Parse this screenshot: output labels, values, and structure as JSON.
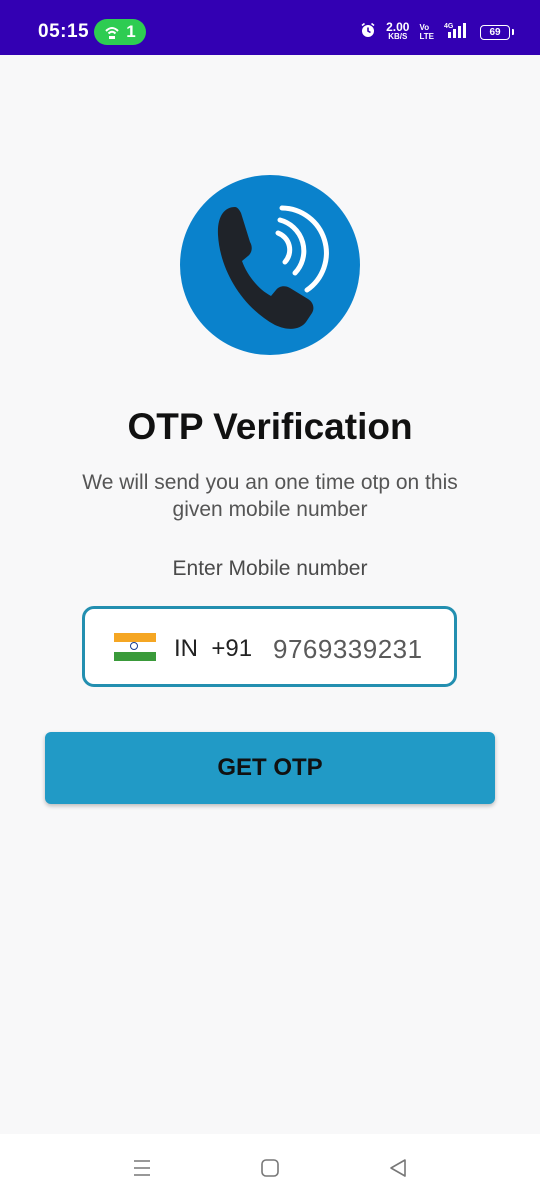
{
  "status_bar": {
    "time": "05:15",
    "hotspot_count": "1",
    "speed_value": "2.00",
    "speed_unit": "KB/S",
    "volte_top": "Vo",
    "volte_bottom": "LTE",
    "network": "4G",
    "battery": "69",
    "background_color": "#3300b3",
    "hotspot_color": "#2ecc52"
  },
  "main": {
    "title": "OTP Verification",
    "subtitle": "We will send you an one time otp on this given mobile number",
    "enter_label": "Enter Mobile number",
    "country_code": "IN  +91",
    "phone_number": "9769339231",
    "button_label": "GET OTP",
    "accent_color": "#219ac6",
    "icon_circle_color": "#0a82cc",
    "icon": "phone-call-icon"
  },
  "nav": {
    "icons": [
      "menu-icon",
      "home-icon",
      "back-icon"
    ]
  }
}
